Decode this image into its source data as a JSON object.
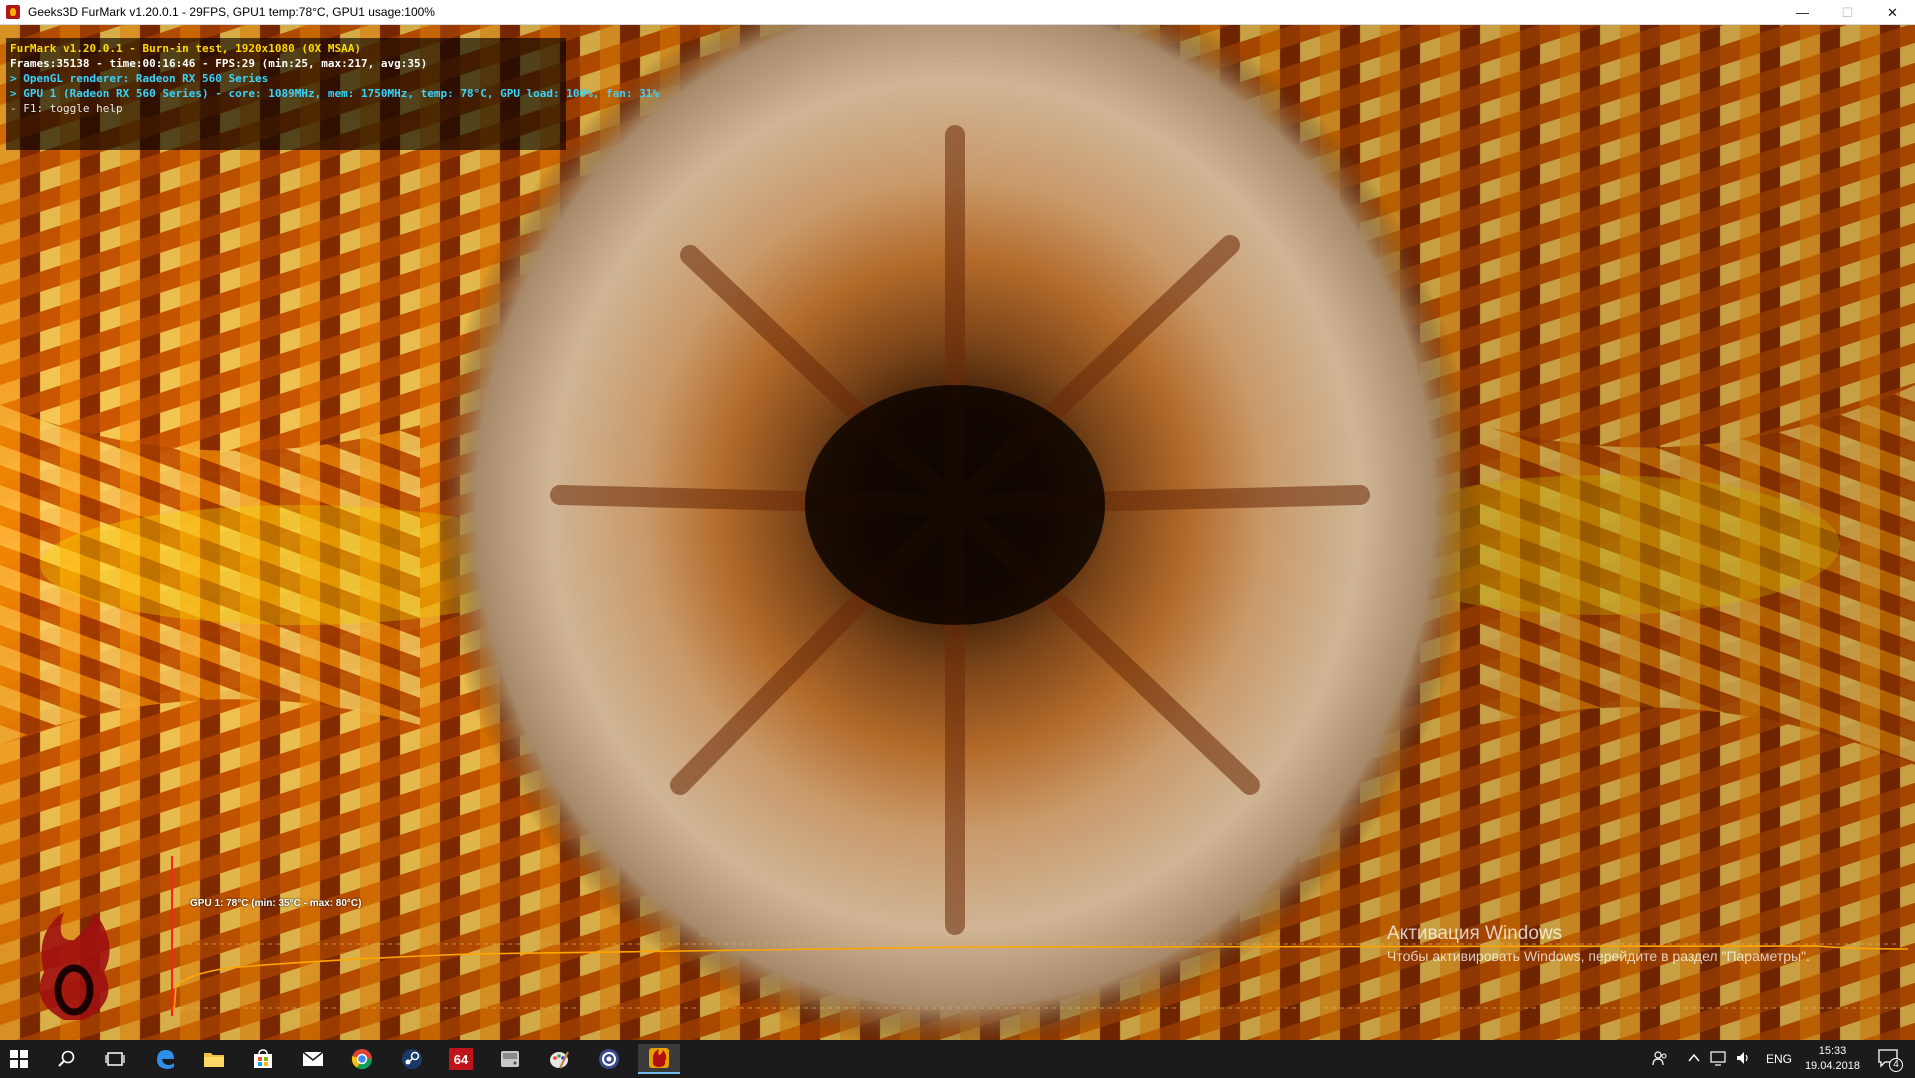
{
  "window": {
    "title": "Geeks3D FurMark v1.20.0.1 - 29FPS, GPU1 temp:78°C, GPU1 usage:100%",
    "minimize": "—",
    "maximize": "☐",
    "close": "✕"
  },
  "hud": {
    "line1": "FurMark v1.20.0.1 - Burn-in test, 1920x1080 (0X MSAA)",
    "line2": "Frames:35138 - time:00:16:46 - FPS:29 (min:25, max:217, avg:35)",
    "line3": "> OpenGL renderer: Radeon RX 560 Series",
    "line4": "> GPU 1 (Radeon RX 560 Series) - core: 1089MHz, mem: 1750MHz, temp: 78°C, GPU load: 100%, fan: 31%",
    "line5": "- F1: toggle help"
  },
  "graph": {
    "label": "GPU 1: 78°C (min: 35°C - max: 80°C)",
    "line_color": "#ffa500",
    "marker_color": "#ff2020"
  },
  "activation": {
    "title": "Активация Windows",
    "subtitle": "Чтобы активировать Windows, перейдите в раздел \"Параметры\"."
  },
  "taskbar": {
    "apps": [
      {
        "name": "start-icon"
      },
      {
        "name": "search-icon"
      },
      {
        "name": "task-view-icon"
      },
      {
        "name": "edge-icon"
      },
      {
        "name": "file-explorer-icon"
      },
      {
        "name": "store-icon"
      },
      {
        "name": "mail-icon"
      },
      {
        "name": "chrome-icon"
      },
      {
        "name": "steam-icon"
      },
      {
        "name": "aida64-icon",
        "label": "64"
      },
      {
        "name": "disk-icon"
      },
      {
        "name": "paint-icon"
      },
      {
        "name": "cpuid-icon"
      },
      {
        "name": "furmark-icon"
      }
    ],
    "language": "ENG",
    "time": "15:33",
    "date": "19.04.2018",
    "notifications": "4"
  },
  "colors": {
    "accent": "#76b9ed",
    "hud_yellow": "#ffd800",
    "hud_cyan": "#38d3ff"
  }
}
